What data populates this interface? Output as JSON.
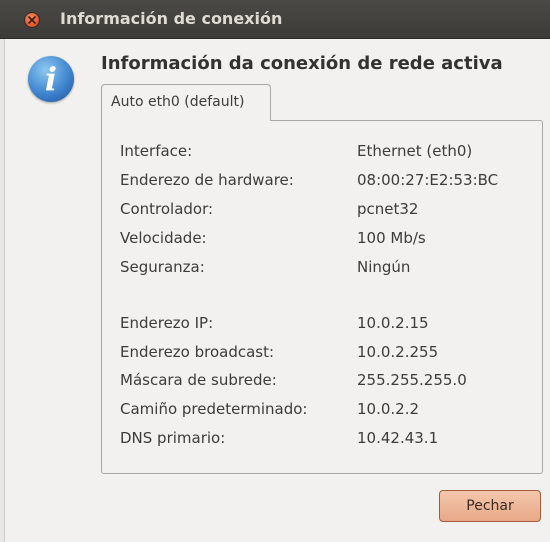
{
  "window": {
    "title": "Información de conexión"
  },
  "dialog": {
    "heading": "Información da conexión de rede activa"
  },
  "tabs": [
    {
      "label": "Auto eth0 (default)"
    }
  ],
  "details": {
    "rows": [
      {
        "label": "Interface:",
        "value": "Ethernet (eth0)"
      },
      {
        "label": "Enderezo de hardware:",
        "value": "08:00:27:E2:53:BC"
      },
      {
        "label": "Controlador:",
        "value": "pcnet32"
      },
      {
        "label": "Velocidade:",
        "value": "100 Mb/s"
      },
      {
        "label": "Seguranza:",
        "value": "Ningún"
      },
      {
        "label": "Enderezo IP:",
        "value": "10.0.2.15"
      },
      {
        "label": "Enderezo broadcast:",
        "value": "10.0.2.255"
      },
      {
        "label": "Máscara de subrede:",
        "value": "255.255.255.0"
      },
      {
        "label": "Camiño predeterminado:",
        "value": "10.0.2.2"
      },
      {
        "label": "DNS primario:",
        "value": "10.42.43.1"
      }
    ]
  },
  "buttons": {
    "close_label": "Pechar"
  },
  "icons": {
    "title_close": "close-icon",
    "dialog": "info-icon"
  },
  "colors": {
    "titlebar": "#3c3b37",
    "close_button": "#e55a2e",
    "info_icon": "#3f86cf",
    "action_button": "#e8a888"
  }
}
